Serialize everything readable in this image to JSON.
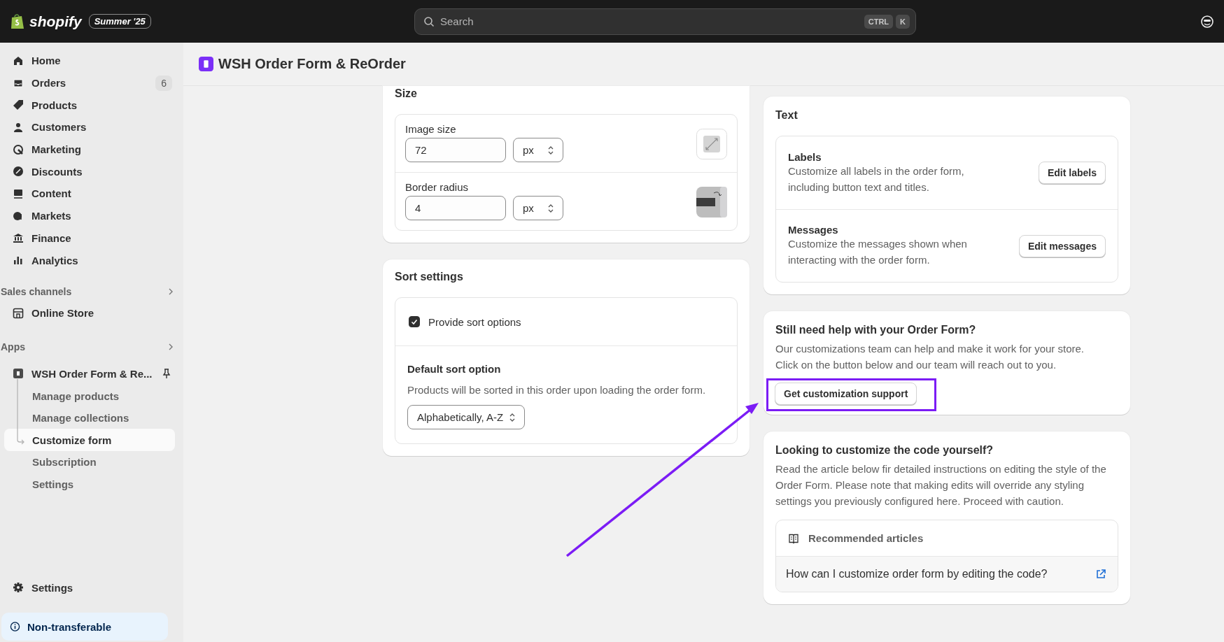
{
  "topbar": {
    "brand": "shopify",
    "edition": "Summer '25",
    "search": {
      "placeholder": "Search",
      "keys": [
        "CTRL",
        "K"
      ]
    }
  },
  "sidebar": {
    "items": [
      {
        "label": "Home",
        "selected": false
      },
      {
        "label": "Orders",
        "selected": false,
        "count": "6"
      },
      {
        "label": "Products",
        "selected": false
      },
      {
        "label": "Customers",
        "selected": false
      },
      {
        "label": "Marketing",
        "selected": false
      },
      {
        "label": "Discounts",
        "selected": false
      },
      {
        "label": "Content",
        "selected": false
      },
      {
        "label": "Markets",
        "selected": false
      },
      {
        "label": "Finance",
        "selected": false
      },
      {
        "label": "Analytics",
        "selected": false
      }
    ],
    "sales_channels": {
      "title": "Sales channels",
      "items": [
        {
          "label": "Online Store",
          "selected": false
        }
      ]
    },
    "apps": {
      "title": "Apps",
      "app": {
        "label": "WSH Order Form & Re...",
        "children": [
          {
            "label": "Manage products",
            "selected": false
          },
          {
            "label": "Manage collections",
            "selected": false
          },
          {
            "label": "Customize form",
            "selected": true
          },
          {
            "label": "Subscription",
            "selected": false
          },
          {
            "label": "Settings",
            "selected": false
          }
        ]
      }
    },
    "settings": {
      "label": "Settings"
    },
    "notice": "Non-transferable"
  },
  "page": {
    "title": "WSH Order Form & ReOrder"
  },
  "size_card": {
    "title": "Size",
    "rows": [
      {
        "label": "Image size",
        "value": "72",
        "unit": "px",
        "kind": "image"
      },
      {
        "label": "Border radius",
        "value": "4",
        "unit": "px",
        "kind": "radius"
      }
    ]
  },
  "sort_card": {
    "title": "Sort settings",
    "option": {
      "label": "Provide sort options",
      "checked": true
    },
    "default": {
      "title": "Default sort option",
      "description": "Products will be sorted in this order upon loading the order form.",
      "value": "Alphabetically, A-Z"
    }
  },
  "text_card": {
    "title": "Text",
    "rows": [
      {
        "title": "Labels",
        "description": "Customize all labels in the order form, including button text and titles.",
        "button": "Edit labels"
      },
      {
        "title": "Messages",
        "description": "Customize the messages shown when interacting with the order form.",
        "button": "Edit messages"
      }
    ]
  },
  "help_card": {
    "title": "Still need help with your Order Form?",
    "lines": [
      "Our customizations team can help and make it work for your store.",
      "Click on the button below and our team will reach out to you."
    ],
    "button": "Get customization support"
  },
  "code_card": {
    "title": "Looking to customize the code yourself?",
    "description": "Read the article below fir detailed instructions on editing the style of the Order Form. Please note that making edits will override any styling settings you previously configured here. Proceed with caution.",
    "articles": {
      "title": "Recommended articles",
      "items": [
        "How can I customize order form by editing the code?"
      ]
    }
  }
}
